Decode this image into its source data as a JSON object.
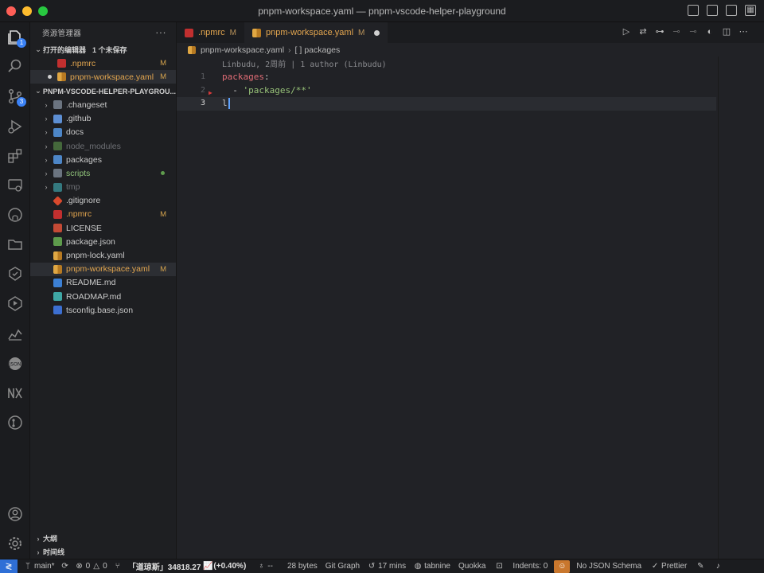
{
  "window": {
    "title": "pnpm-workspace.yaml — pnpm-vscode-helper-playground"
  },
  "activity": {
    "explorer_badge": "1",
    "scm_badge": "3"
  },
  "sidebar": {
    "title": "资源管理器",
    "more": "···",
    "open_editors": {
      "label": "打开的编辑器",
      "unsaved": "1 个未保存",
      "items": [
        {
          "name": ".npmrc",
          "status": "M"
        },
        {
          "name": "pnpm-workspace.yaml",
          "status": "M"
        }
      ]
    },
    "project": {
      "label": "PNPM-VSCODE-HELPER-PLAYGROU...",
      "items": [
        {
          "name": ".changeset",
          "status": ""
        },
        {
          "name": ".github",
          "status": ""
        },
        {
          "name": "docs",
          "status": ""
        },
        {
          "name": "node_modules",
          "status": ""
        },
        {
          "name": "packages",
          "status": ""
        },
        {
          "name": "scripts",
          "status": ""
        },
        {
          "name": "tmp",
          "status": ""
        },
        {
          "name": ".gitignore",
          "status": ""
        },
        {
          "name": ".npmrc",
          "status": "M"
        },
        {
          "name": "LICENSE",
          "status": ""
        },
        {
          "name": "package.json",
          "status": ""
        },
        {
          "name": "pnpm-lock.yaml",
          "status": ""
        },
        {
          "name": "pnpm-workspace.yaml",
          "status": "M"
        },
        {
          "name": "README.md",
          "status": ""
        },
        {
          "name": "ROADMAP.md",
          "status": ""
        },
        {
          "name": "tsconfig.base.json",
          "status": ""
        }
      ]
    },
    "outline": "大纲",
    "timeline": "时间线"
  },
  "tabs": [
    {
      "label": ".npmrc",
      "status": "M"
    },
    {
      "label": "pnpm-workspace.yaml",
      "status": "M"
    }
  ],
  "breadcrumb": {
    "file": "pnpm-workspace.yaml",
    "symbol_icon": "[ ]",
    "symbol": "packages"
  },
  "blame": "Linbudu, 2周前 | 1 author (Linbudu)",
  "code": {
    "line_numbers": [
      "1",
      "2",
      "3"
    ],
    "l1_key": "packages",
    "l1_colon": ":",
    "l2_dash": "  - ",
    "l2_str": "'packages/**'",
    "l3_text": "l"
  },
  "status": {
    "branch": "main*",
    "errors": "0",
    "warnings": "0",
    "stock": "「道琼斯」34818.27",
    "stock_change": "(+0.40%)",
    "dashes": "--",
    "bytes": "28 bytes",
    "git_graph": "Git Graph",
    "time": "17 mins",
    "tabnine": "tabnine",
    "quokka": "Quokka",
    "indents": "Indents: 0",
    "json_schema": "No JSON Schema",
    "prettier": "Prettier"
  },
  "colors": {
    "accent_blue": "#2f6fd6",
    "modified": "#e3a64f",
    "untracked": "#8fc27a"
  }
}
